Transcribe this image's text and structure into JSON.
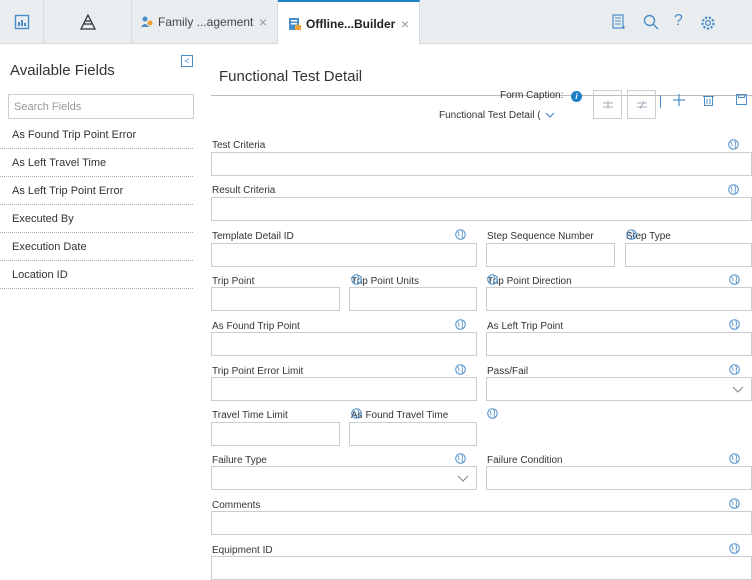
{
  "topbar": {
    "tabs": [
      {
        "label": "Family ...agement",
        "icon": "family-icon",
        "close": "×"
      },
      {
        "label": "Offline...Builder",
        "icon": "form-icon",
        "close": "×"
      }
    ],
    "icons": [
      "dashboard-icon",
      "pyramid-icon",
      "notebook-icon",
      "search-icon",
      "help-icon",
      "settings-icon"
    ],
    "help_glyph": "?"
  },
  "sidebar": {
    "title": "Available Fields",
    "collapse_glyph": "<",
    "search_placeholder": "Search Fields",
    "items": [
      {
        "label": "As Found Trip Point Error"
      },
      {
        "label": "As Left Travel Time"
      },
      {
        "label": "As Left Trip Point Error"
      },
      {
        "label": "Executed By"
      },
      {
        "label": "Execution Date"
      },
      {
        "label": "Location ID"
      }
    ]
  },
  "main": {
    "title": "Functional Test Detail",
    "form_caption_label": "Form Caption:",
    "form_caption_value": "Functional Test Detail (",
    "fields": {
      "test_criteria": "Test Criteria",
      "result_criteria": "Result Criteria",
      "template_detail_id": "Template Detail ID",
      "step_sequence_number": "Step Sequence Number",
      "step_type": "Step Type",
      "trip_point": "Trip Point",
      "trip_point_units": "Trip Point Units",
      "trip_point_direction": "Trip Point Direction",
      "as_found_trip_point": "As Found Trip Point",
      "as_left_trip_point": "As Left Trip Point",
      "trip_point_error_limit": "Trip Point Error Limit",
      "pass_fail": "Pass/Fail",
      "travel_time_limit": "Travel Time Limit",
      "as_found_travel_time": "As Found Travel Time",
      "failure_type": "Failure Type",
      "failure_condition": "Failure Condition",
      "comments": "Comments",
      "equipment_id": "Equipment ID"
    }
  },
  "colors": {
    "accent": "#1f7fc6",
    "icon": "#4a8cc8",
    "topbar": "#eaedf0"
  }
}
